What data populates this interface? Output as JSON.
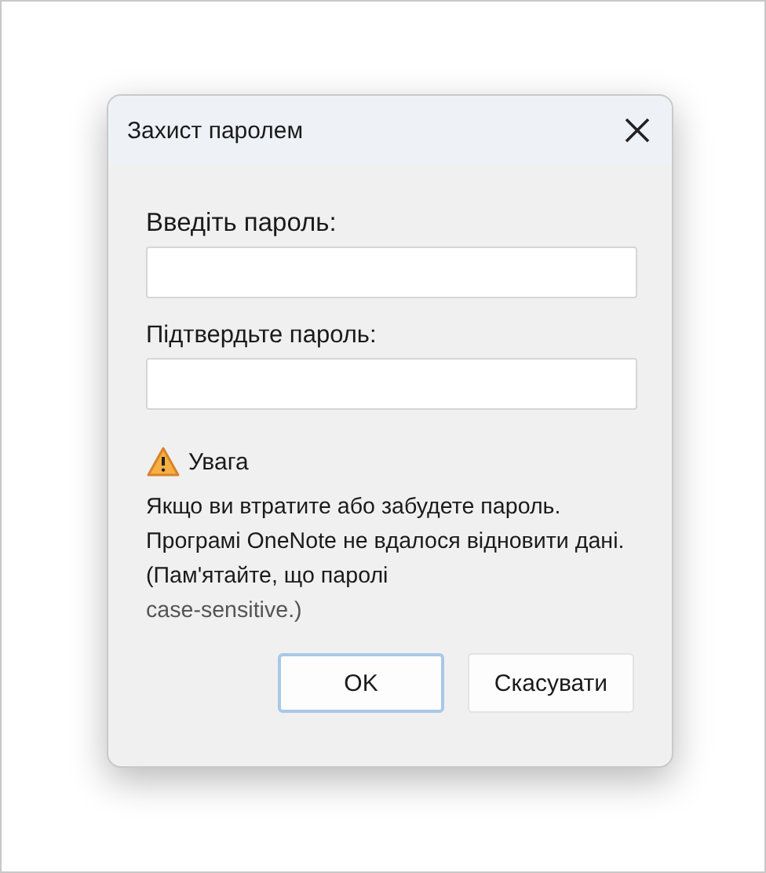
{
  "window": {
    "title": "Захист паролем"
  },
  "fields": [
    {
      "label": "Введіть пароль:"
    },
    {
      "label": "Підтвердьте пароль:"
    }
  ],
  "warning": {
    "heading": "Увага",
    "lines": [
      "Якщо ви втратите або забудете пароль.",
      "Програмі OneNote не вдалося відновити дані.",
      "(Пам'ятайте, що паролі",
      "case-sensitive.)"
    ]
  },
  "buttons": [
    {
      "label": "OK",
      "default": true
    },
    {
      "label": "Скасувати",
      "default": false
    }
  ]
}
